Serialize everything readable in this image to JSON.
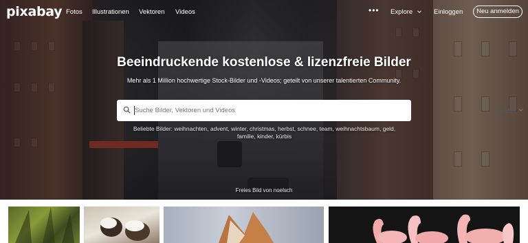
{
  "brand": {
    "logo": "pixabay"
  },
  "nav": {
    "items": [
      "Fotos",
      "Illustrationen",
      "Vektoren",
      "Videos"
    ],
    "more": "•••",
    "explore": "Explore",
    "login": "Einloggen",
    "signup": "Neu anmelden"
  },
  "hero": {
    "headline": "Beeindruckende kostenlose & lizenzfreie Bilder",
    "subline": "Mehr als 1 Million hochwertige Stock-Bilder und -Videos; geteilt von unserer talentierten Community.",
    "credit": "Freies Bild von noelsch"
  },
  "search": {
    "placeholder": "Suche Bilder, Vektoren und Videos",
    "type": "Bilder"
  },
  "popular": {
    "label": "Beliebte Bilder:",
    "terms": "weihnachten, advent, winter, christmas, herbst, schnee, team, weihnachtsbaum, geld, familie, kinder, kürbis"
  },
  "colors": {
    "accent_red": "#e1251b"
  }
}
